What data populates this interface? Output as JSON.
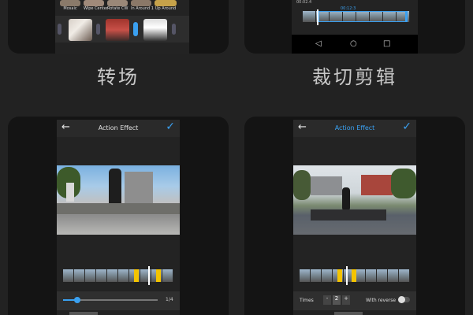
{
  "captions": {
    "top_left": "转场",
    "top_right": "裁切剪辑"
  },
  "transitions": {
    "effects": [
      "Mosaic",
      "Wipe Center",
      "Rotate CW",
      "In Around 1",
      "Up Around"
    ]
  },
  "crop": {
    "time_badge": "00:02.4",
    "duration": "00:12:3"
  },
  "action_effect_left": {
    "title": "Action Effect",
    "slider_count": "1/4",
    "slider_level": 0.15
  },
  "action_effect_right": {
    "title": "Action Effect",
    "times_label": "Times",
    "times_minus": "-",
    "times_value": "2",
    "times_plus": "+",
    "reverse_label": "With reverse",
    "reverse_on": false
  },
  "colors": {
    "accent_blue": "#3aa0f0",
    "handle_yellow": "#f4c400"
  }
}
